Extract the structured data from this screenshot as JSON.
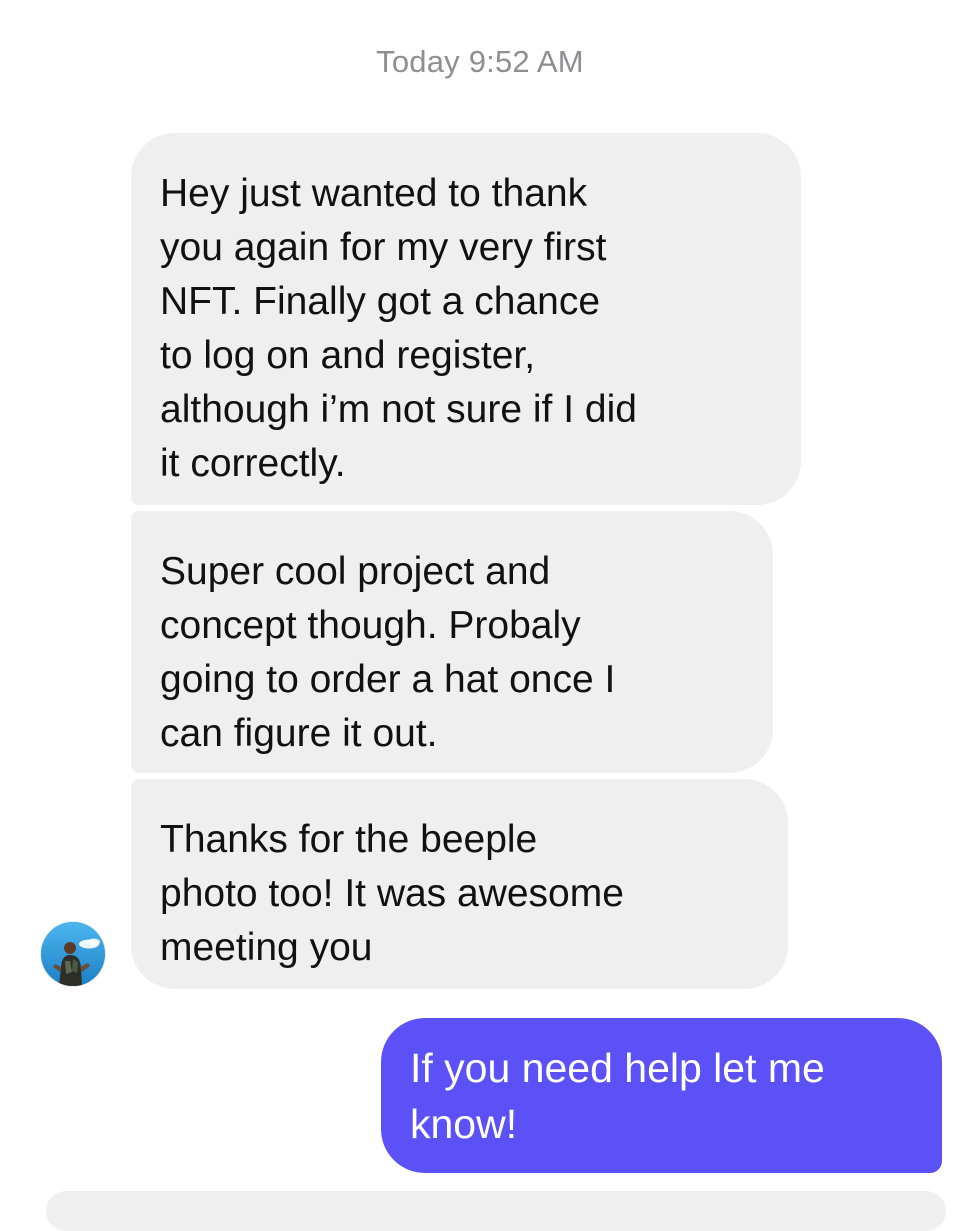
{
  "conversation": {
    "timestamp": "Today 9:52 AM",
    "messages": [
      {
        "direction": "incoming",
        "lines": [
          "Hey just wanted to thank",
          "you again for my very first",
          "NFT. Finally got a chance",
          "to log on and register,",
          "although i’m not sure if I did",
          "it correctly."
        ]
      },
      {
        "direction": "incoming",
        "lines": [
          "Super cool project and",
          "concept though. Probaly",
          "going to order a hat once I",
          "can figure it out."
        ]
      },
      {
        "direction": "incoming",
        "lines": [
          "Thanks for the beeple",
          "photo too! It was awesome",
          "meeting you"
        ]
      },
      {
        "direction": "outgoing",
        "lines": [
          "If you need help let me",
          "know!"
        ]
      }
    ]
  },
  "contact": {
    "avatar_icon": "user-avatar-photo-icon"
  },
  "colors": {
    "incoming_bubble": "#efefef",
    "outgoing_bubble": "#5b51f6",
    "timestamp_text": "#8e8e93"
  }
}
